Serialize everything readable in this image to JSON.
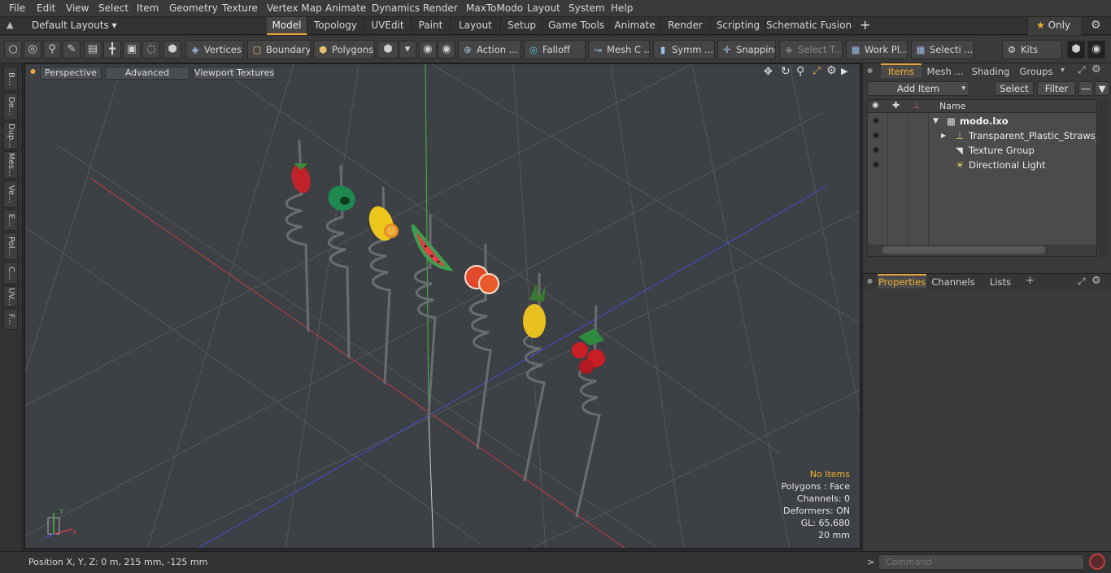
{
  "menu": [
    "File",
    "Edit",
    "View",
    "Select",
    "Item",
    "Geometry",
    "Texture",
    "Vertex Map",
    "Animate",
    "Dynamics",
    "Render",
    "MaxToModo",
    "Layout",
    "System",
    "Help"
  ],
  "layout_selector": "Default Layouts",
  "layout_tabs": [
    {
      "label": "Model",
      "active": true
    },
    {
      "label": "Topology"
    },
    {
      "label": "UVEdit"
    },
    {
      "label": "Paint"
    },
    {
      "label": "Layout"
    },
    {
      "label": "Setup"
    },
    {
      "label": "Game Tools"
    },
    {
      "label": "Animate"
    },
    {
      "label": "Render"
    },
    {
      "label": "Scripting"
    },
    {
      "label": "Schematic Fusion"
    }
  ],
  "layout_add": "+",
  "only_label": "Only",
  "toolbar": {
    "vertices": "Vertices",
    "boundary": "Boundary",
    "polygons": "Polygons",
    "action": "Action",
    "falloff": "Falloff",
    "mesh_c": "Mesh C ...",
    "symm": "Symm ...",
    "snapping": "Snapping",
    "select_t": "Select T...",
    "work_pl": "Work Pl...",
    "selecti": "Selecti ...",
    "kits": "Kits"
  },
  "left_tabs": [
    "B...",
    "De...",
    "Dup...",
    "Mes...",
    "Ve...",
    "E...",
    "Pol...",
    "C...",
    "UV...",
    "F..."
  ],
  "viewport": {
    "perspective": "Perspective",
    "advanced": "Advanced",
    "viewport_textures": "Viewport Textures",
    "stats": {
      "no_items": "No Items",
      "polygons": "Polygons : Face",
      "channels": "Channels: 0",
      "deformers": "Deformers: ON",
      "gl": "GL: 65,680",
      "scale": "20 mm"
    }
  },
  "status": {
    "position": "Position X, Y, Z:  0 m, 215 mm, -125 mm"
  },
  "items_panel": {
    "tabs": [
      "Items",
      "Mesh ...",
      "Shading",
      "Groups"
    ],
    "add_item": "Add Item",
    "select": "Select",
    "filter": "Filter",
    "column_name": "Name",
    "rows": [
      {
        "label": "modo.lxo",
        "bold": true,
        "indent": 0
      },
      {
        "label": "Transparent_Plastic_Straws_...",
        "bold": false,
        "indent": 1
      },
      {
        "label": "Texture Group",
        "bold": false,
        "indent": 1
      },
      {
        "label": "Directional Light",
        "bold": false,
        "indent": 1
      }
    ]
  },
  "props_panel": {
    "tabs": [
      "Properties",
      "Channels",
      "Lists"
    ],
    "add": "+"
  },
  "command": {
    "placeholder": "Command",
    "prompt": ">"
  },
  "colors": {
    "accent": "#e8a43a",
    "viewport_bg": "#3d4044",
    "x_axis": "#c04040",
    "y_axis": "#40c040",
    "z_axis": "#4050d0"
  }
}
